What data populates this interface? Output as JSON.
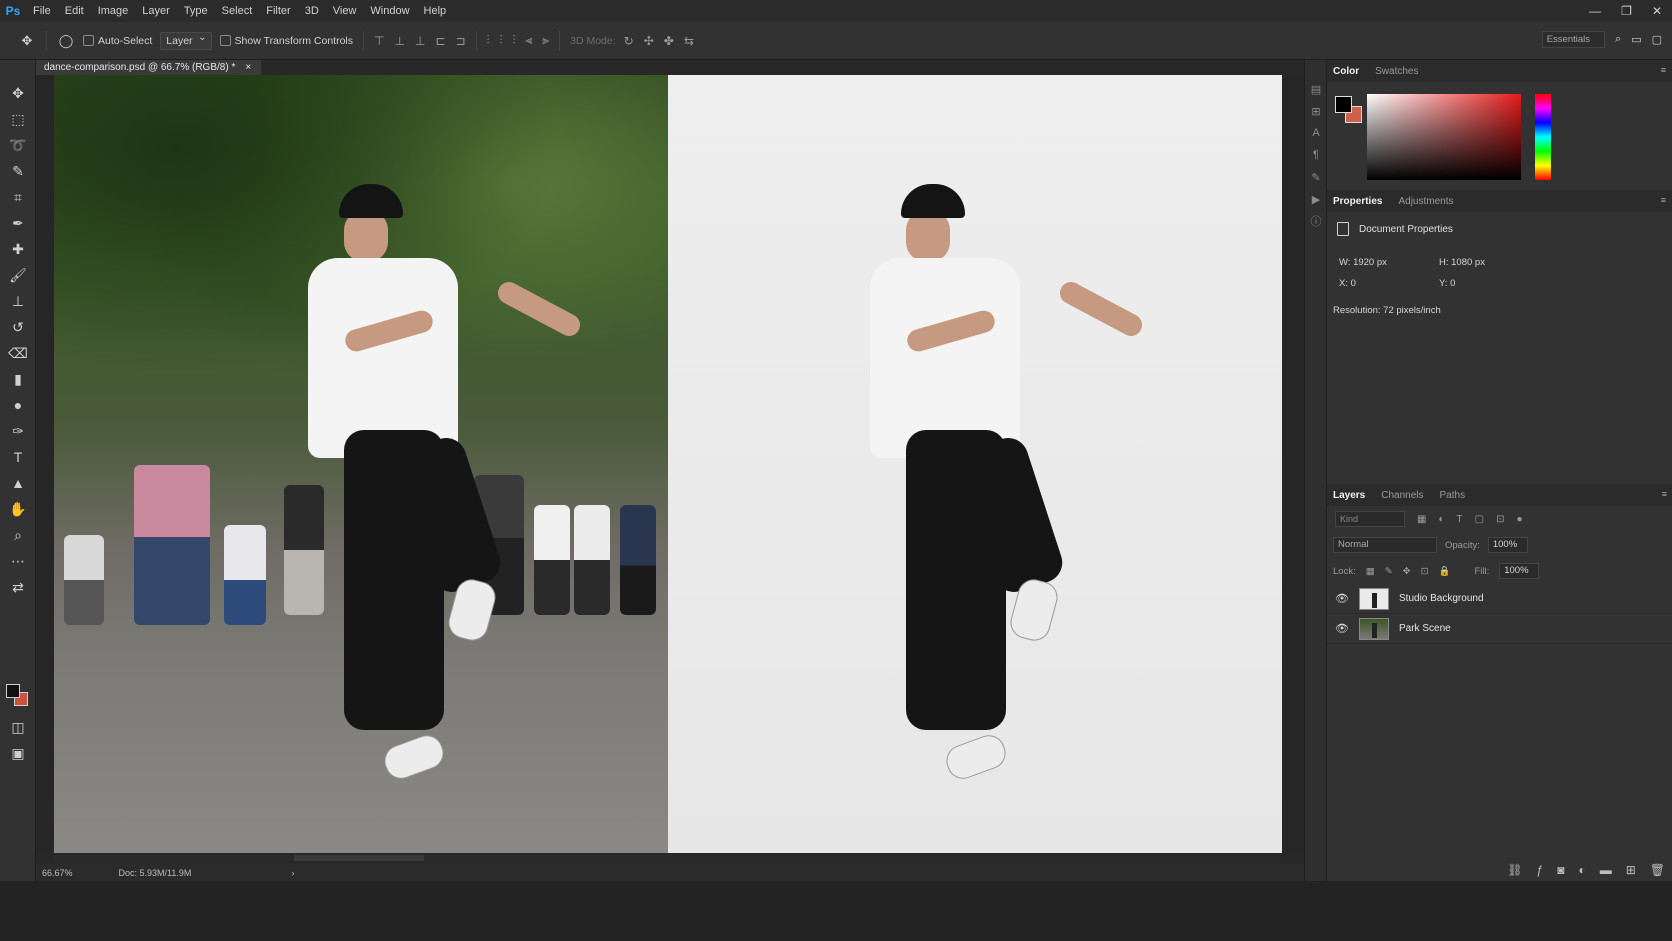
{
  "app": {
    "logo": "Ps"
  },
  "menu": [
    "File",
    "Edit",
    "Image",
    "Layer",
    "Type",
    "Select",
    "Filter",
    "3D",
    "View",
    "Window",
    "Help"
  ],
  "window_controls": {
    "minimize": "—",
    "restore": "❐",
    "close": "✕"
  },
  "options": {
    "auto_select_label": "Auto-Select",
    "target_value": "Layer",
    "transform_label": "Show Transform Controls",
    "mode_3d_label": "3D Mode:",
    "workspace_value": "Essentials"
  },
  "document": {
    "tab_title": "dance-comparison.psd @ 66.7% (RGB/8) *",
    "tab_close": "×"
  },
  "status": {
    "zoom": "66.67%",
    "doc_size": "Doc: 5.93M/11.9M",
    "arrow": "›"
  },
  "color_panel": {
    "tabs": [
      "Color",
      "Swatches"
    ],
    "foreground": "#000000",
    "background": "#d0604a"
  },
  "properties_panel": {
    "tabs": [
      "Properties",
      "Adjustments"
    ],
    "title": "Document Properties",
    "width": "W: 1920 px",
    "height": "H: 1080 px",
    "x": "X: 0",
    "y": "Y: 0",
    "resolution": "Resolution: 72 pixels/inch"
  },
  "layers_panel": {
    "tabs": [
      "Layers",
      "Channels",
      "Paths"
    ],
    "kind_placeholder": "Kind",
    "blend_mode": "Normal",
    "opacity_label": "Opacity:",
    "opacity_value": "100%",
    "lock_label": "Lock:",
    "fill_label": "Fill:",
    "fill_value": "100%",
    "layers": [
      {
        "name": "Studio Background",
        "visible": true
      },
      {
        "name": "Park Scene",
        "visible": true
      }
    ]
  },
  "panel_menu_glyph": "≡"
}
